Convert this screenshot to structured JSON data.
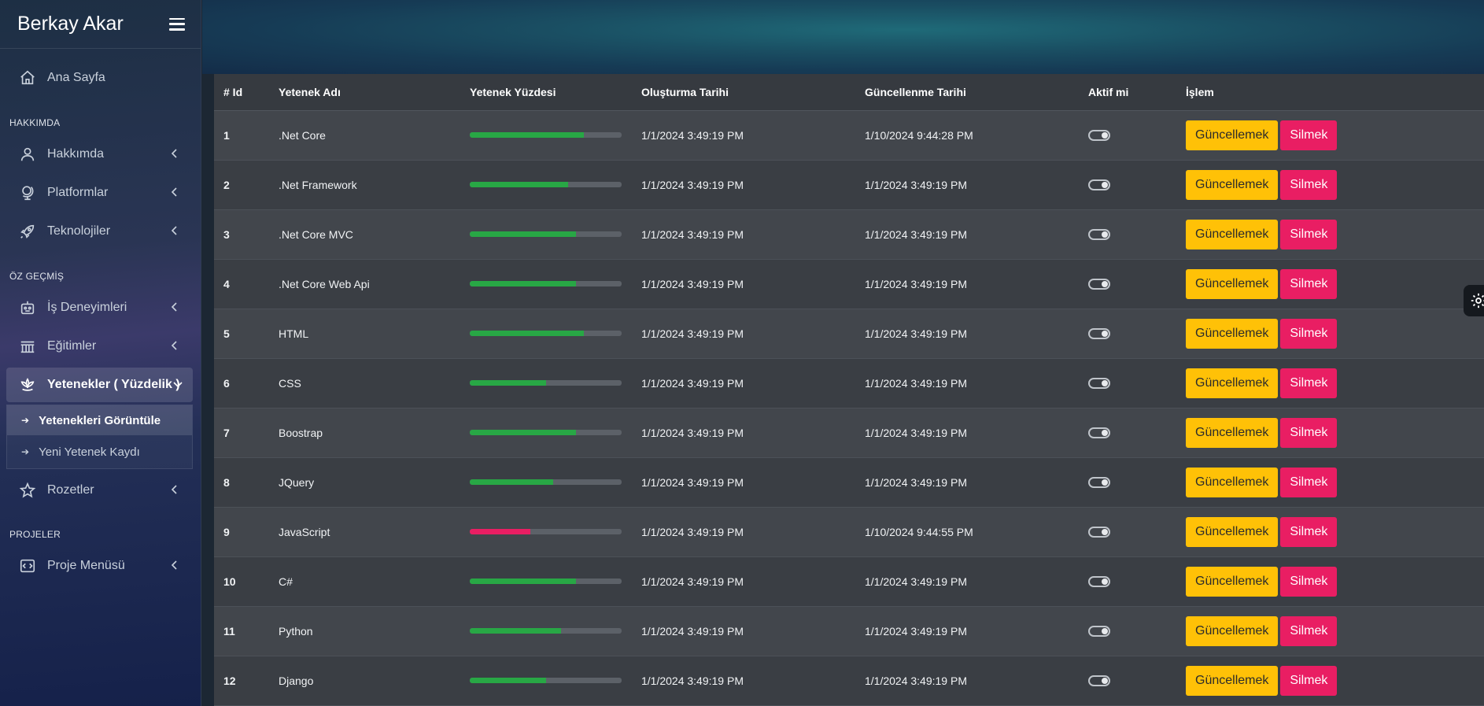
{
  "brand": {
    "title": "Berkay Akar"
  },
  "sidebar": {
    "home": "Ana Sayfa",
    "sections": {
      "about": "HAKKIMDA",
      "cv": "ÖZ GEÇMİŞ",
      "projects": "PROJELER"
    },
    "items": {
      "about": "Hakkımda",
      "platforms": "Platformlar",
      "technologies": "Teknolojiler",
      "experience": "İş Deneyimleri",
      "education": "Eğitimler",
      "skills": "Yetenekler ( Yüzdelik )",
      "badges": "Rozetler",
      "project_menu": "Proje Menüsü"
    },
    "submenu": {
      "view": "Yetenekleri Görüntüle",
      "new": "Yeni Yetenek Kaydı"
    }
  },
  "table": {
    "headers": {
      "id": "# Id",
      "name": "Yetenek Adı",
      "percent": "Yetenek Yüzdesi",
      "created": "Oluşturma Tarihi",
      "updated": "Güncellenme Tarihi",
      "active": "Aktif mi",
      "action": "İşlem"
    },
    "buttons": {
      "update": "Güncellemek",
      "delete": "Silmek"
    },
    "colors": {
      "high": "#28a745",
      "low": "#e91e63"
    },
    "rows": [
      {
        "id": "1",
        "name": ".Net Core",
        "percent": 75,
        "created": "1/1/2024 3:49:19 PM",
        "updated": "1/10/2024 9:44:28 PM",
        "active": true
      },
      {
        "id": "2",
        "name": ".Net Framework",
        "percent": 65,
        "created": "1/1/2024 3:49:19 PM",
        "updated": "1/1/2024 3:49:19 PM",
        "active": true
      },
      {
        "id": "3",
        "name": ".Net Core MVC",
        "percent": 70,
        "created": "1/1/2024 3:49:19 PM",
        "updated": "1/1/2024 3:49:19 PM",
        "active": true
      },
      {
        "id": "4",
        "name": ".Net Core Web Api",
        "percent": 70,
        "created": "1/1/2024 3:49:19 PM",
        "updated": "1/1/2024 3:49:19 PM",
        "active": true
      },
      {
        "id": "5",
        "name": "HTML",
        "percent": 75,
        "created": "1/1/2024 3:49:19 PM",
        "updated": "1/1/2024 3:49:19 PM",
        "active": true
      },
      {
        "id": "6",
        "name": "CSS",
        "percent": 50,
        "created": "1/1/2024 3:49:19 PM",
        "updated": "1/1/2024 3:49:19 PM",
        "active": true
      },
      {
        "id": "7",
        "name": "Boostrap",
        "percent": 70,
        "created": "1/1/2024 3:49:19 PM",
        "updated": "1/1/2024 3:49:19 PM",
        "active": true
      },
      {
        "id": "8",
        "name": "JQuery",
        "percent": 55,
        "created": "1/1/2024 3:49:19 PM",
        "updated": "1/1/2024 3:49:19 PM",
        "active": true
      },
      {
        "id": "9",
        "name": "JavaScript",
        "percent": 40,
        "created": "1/1/2024 3:49:19 PM",
        "updated": "1/10/2024 9:44:55 PM",
        "active": true
      },
      {
        "id": "10",
        "name": "C#",
        "percent": 70,
        "created": "1/1/2024 3:49:19 PM",
        "updated": "1/1/2024 3:49:19 PM",
        "active": true
      },
      {
        "id": "11",
        "name": "Python",
        "percent": 60,
        "created": "1/1/2024 3:49:19 PM",
        "updated": "1/1/2024 3:49:19 PM",
        "active": true
      },
      {
        "id": "12",
        "name": "Django",
        "percent": 50,
        "created": "1/1/2024 3:49:19 PM",
        "updated": "1/1/2024 3:49:19 PM",
        "active": true
      }
    ]
  }
}
